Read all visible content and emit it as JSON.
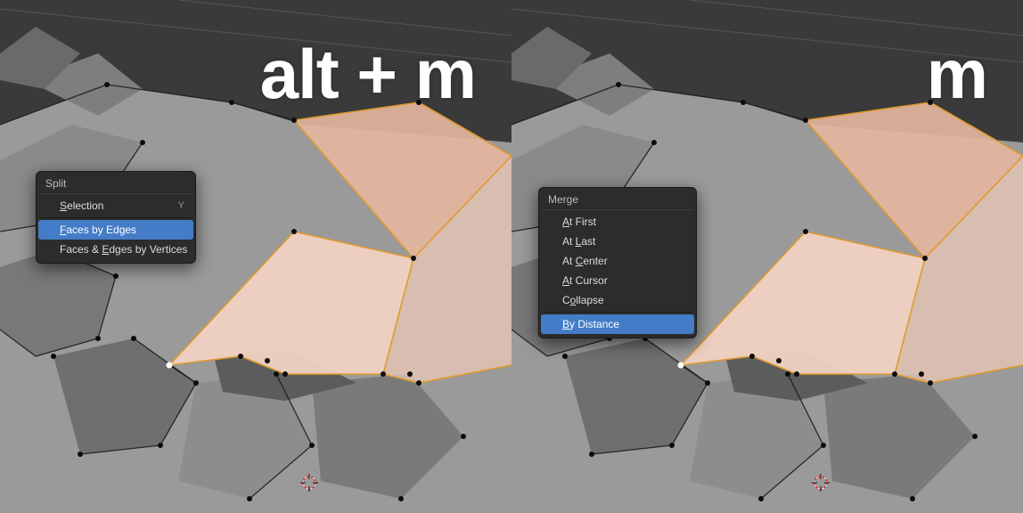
{
  "left": {
    "shortcut_label": "alt + m",
    "menu": {
      "title": "Split",
      "items": [
        {
          "label_pre": "",
          "mn": "S",
          "label_post": "election",
          "shortcut": "Y",
          "highlight": false
        },
        {
          "label_pre": "",
          "mn": "F",
          "label_post": "aces by Edges",
          "shortcut": "",
          "highlight": true
        },
        {
          "label_pre": "Faces & ",
          "mn": "E",
          "label_post": "dges by Vertices",
          "shortcut": "",
          "highlight": false
        }
      ]
    }
  },
  "right": {
    "shortcut_label": "m",
    "menu": {
      "title": "Merge",
      "items": [
        {
          "label_pre": "",
          "mn": "A",
          "label_post": "t First",
          "shortcut": "",
          "highlight": false
        },
        {
          "label_pre": "At ",
          "mn": "L",
          "label_post": "ast",
          "shortcut": "",
          "highlight": false
        },
        {
          "label_pre": "At ",
          "mn": "C",
          "label_post": "enter",
          "shortcut": "",
          "highlight": false
        },
        {
          "label_pre": "",
          "mn": "A",
          "label_post": "t Cursor",
          "shortcut": "",
          "highlight": false
        },
        {
          "label_pre": "C",
          "mn": "o",
          "label_post": "llapse",
          "shortcut": "",
          "highlight": false
        },
        {
          "sep": true
        },
        {
          "label_pre": "",
          "mn": "B",
          "label_post": "y Distance",
          "shortcut": "",
          "highlight": true
        }
      ]
    }
  },
  "mesh": {
    "grid_line": "#3a3a3a",
    "bg_top": "#3b3b3b",
    "bg_mesh_grey": "#9d9d9d",
    "bg_mesh_dark": "#5c5c5c",
    "selected_face_fill": "#e7bfa9",
    "selected_face_fill2": "#f2d4c4",
    "selected_edge": "#e09a2f",
    "edge": "#1c1c1c",
    "vertex": "#000000",
    "vertex_sel": "#ffffff"
  }
}
